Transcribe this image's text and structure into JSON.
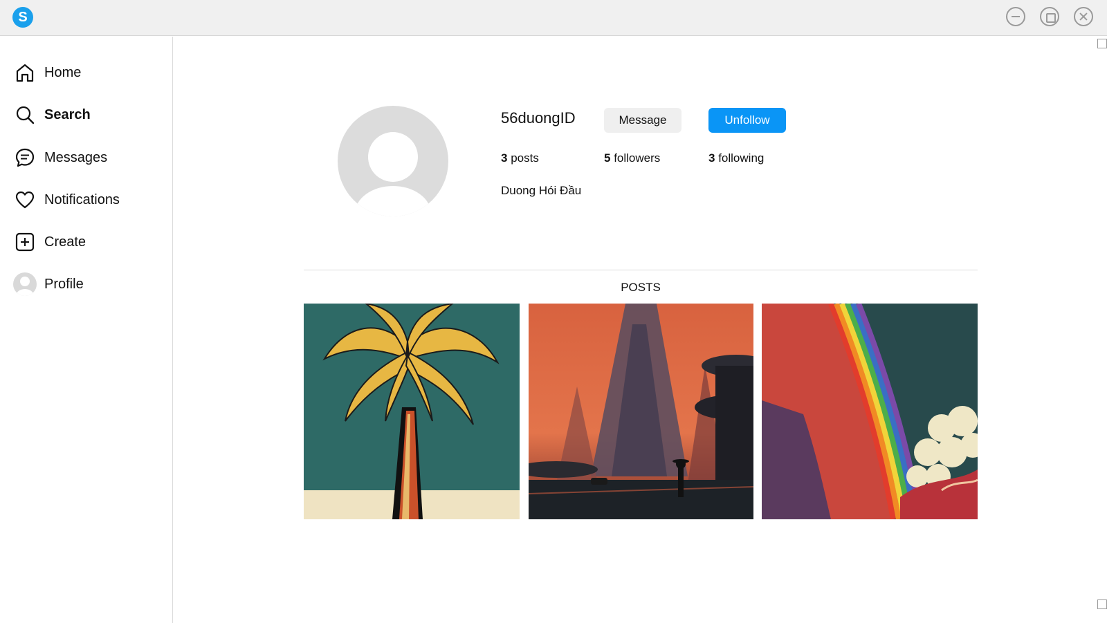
{
  "window": {
    "app_icon": "skype-s-logo",
    "app_letter": "S",
    "controls": [
      "minimize-icon",
      "maximize-icon",
      "close-icon"
    ]
  },
  "sidebar": {
    "items": [
      {
        "label": "Home",
        "icon": "home-icon"
      },
      {
        "label": "Search",
        "icon": "search-icon",
        "active": true
      },
      {
        "label": "Messages",
        "icon": "message-icon"
      },
      {
        "label": "Notifications",
        "icon": "heart-icon"
      },
      {
        "label": "Create",
        "icon": "plus-square-icon"
      },
      {
        "label": "Profile",
        "icon": "avatar"
      }
    ]
  },
  "profile": {
    "username": "56duongID",
    "message_button": "Message",
    "unfollow_button": "Unfollow",
    "posts_count": "3",
    "posts_word": "posts",
    "followers_count": "5",
    "followers_word": "followers",
    "following_count": "3",
    "following_word": "following",
    "full_name": "Duong Hói Đầu"
  },
  "posts_section": {
    "label": "POSTS"
  },
  "colors": {
    "accent": "#0a95f6",
    "button_grey": "#efefef",
    "divider": "#dbdbdb"
  }
}
